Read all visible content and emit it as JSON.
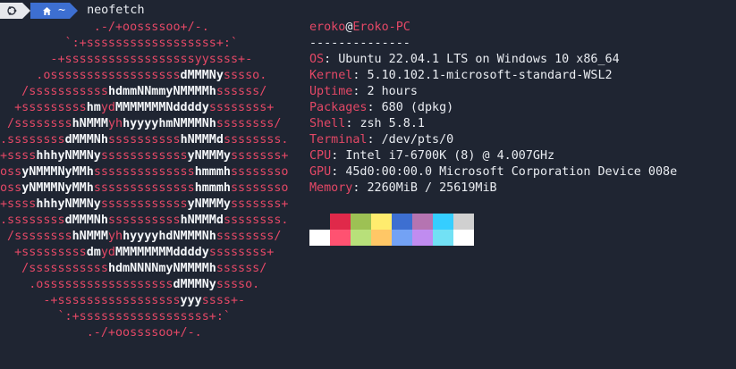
{
  "prompt": {
    "os_icon": "ubuntu-terminal-icon",
    "home_icon": "home-icon",
    "dir": "~",
    "command": "neofetch",
    "colors": {
      "os_segment": "#e6e8ec",
      "dir_segment": "#3d6fd1"
    }
  },
  "logo_lines": [
    [
      [
        "r",
        "             .-/+oossssoo+/-."
      ]
    ],
    [
      [
        "r",
        "         `:+ssssssssssssssssss+:`"
      ]
    ],
    [
      [
        "r",
        "       -+ssssssssssssssssssyyssss+-"
      ]
    ],
    [
      [
        "r",
        "     .ossssssssssssssssss"
      ],
      [
        "w",
        "dMMMNy"
      ],
      [
        "r",
        "sssso."
      ]
    ],
    [
      [
        "r",
        "   /sssssssssss"
      ],
      [
        "w",
        "hdmmNNmmyNMMMMh"
      ],
      [
        "r",
        "ssssss/"
      ]
    ],
    [
      [
        "r",
        "  +sssssssss"
      ],
      [
        "w",
        "hm"
      ],
      [
        "r",
        "yd"
      ],
      [
        "w",
        "MMMMMMMNddddy"
      ],
      [
        "r",
        "ssssssss+"
      ]
    ],
    [
      [
        "r",
        " /ssssssss"
      ],
      [
        "w",
        "hNMMM"
      ],
      [
        "r",
        "yh"
      ],
      [
        "w",
        "hyyyyhmNMMMNh"
      ],
      [
        "r",
        "ssssssss/"
      ]
    ],
    [
      [
        "r",
        ".ssssssss"
      ],
      [
        "w",
        "dMMMNh"
      ],
      [
        "r",
        "ssssssssss"
      ],
      [
        "w",
        "hNMMMd"
      ],
      [
        "r",
        "ssssssss."
      ]
    ],
    [
      [
        "r",
        "+ssss"
      ],
      [
        "w",
        "hhhyNMMNy"
      ],
      [
        "r",
        "ssssssssssss"
      ],
      [
        "w",
        "yNMMMy"
      ],
      [
        "r",
        "sssssss+"
      ]
    ],
    [
      [
        "r",
        "oss"
      ],
      [
        "w",
        "yNMMMNyMMh"
      ],
      [
        "r",
        "ssssssssssssss"
      ],
      [
        "w",
        "hmmmh"
      ],
      [
        "r",
        "ssssssso"
      ]
    ],
    [
      [
        "r",
        "oss"
      ],
      [
        "w",
        "yNMMMNyMMh"
      ],
      [
        "r",
        "ssssssssssssss"
      ],
      [
        "w",
        "hmmmh"
      ],
      [
        "r",
        "ssssssso"
      ]
    ],
    [
      [
        "r",
        "+ssss"
      ],
      [
        "w",
        "hhhyNMMNy"
      ],
      [
        "r",
        "ssssssssssss"
      ],
      [
        "w",
        "yNMMMy"
      ],
      [
        "r",
        "sssssss+"
      ]
    ],
    [
      [
        "r",
        ".ssssssss"
      ],
      [
        "w",
        "dMMMNh"
      ],
      [
        "r",
        "ssssssssss"
      ],
      [
        "w",
        "hNMMMd"
      ],
      [
        "r",
        "ssssssss."
      ]
    ],
    [
      [
        "r",
        " /ssssssss"
      ],
      [
        "w",
        "hNMMM"
      ],
      [
        "r",
        "yh"
      ],
      [
        "w",
        "hyyyyhdNMMMNh"
      ],
      [
        "r",
        "ssssssss/"
      ]
    ],
    [
      [
        "r",
        "  +sssssssss"
      ],
      [
        "w",
        "dm"
      ],
      [
        "r",
        "yd"
      ],
      [
        "w",
        "MMMMMMMMddddy"
      ],
      [
        "r",
        "ssssssss+"
      ]
    ],
    [
      [
        "r",
        "   /sssssssssss"
      ],
      [
        "w",
        "hdmNNNNmyNMMMMh"
      ],
      [
        "r",
        "ssssss/"
      ]
    ],
    [
      [
        "r",
        "    .ossssssssssssssssss"
      ],
      [
        "w",
        "dMMMNy"
      ],
      [
        "r",
        "sssso."
      ]
    ],
    [
      [
        "r",
        "      -+sssssssssssssssss"
      ],
      [
        "w",
        "yyy"
      ],
      [
        "r",
        "ssss+-"
      ]
    ],
    [
      [
        "r",
        "        `:+ssssssssssssssssss+:`"
      ]
    ],
    [
      [
        "r",
        "            .-/+oossssoo+/-."
      ]
    ]
  ],
  "info": {
    "user": "eroko",
    "at": "@",
    "host": "Eroko-PC",
    "separator": "--------------",
    "os_label": "OS",
    "os_value": "Ubuntu 22.04.1 LTS on Windows 10 x86_64",
    "kernel_label": "Kernel",
    "kernel_value": "5.10.102.1-microsoft-standard-WSL2",
    "uptime_label": "Uptime",
    "uptime_value": "2 hours",
    "packages_label": "Packages",
    "packages_value": "680 (dpkg)",
    "shell_label": "Shell",
    "shell_value": "zsh 5.8.1",
    "terminal_label": "Terminal",
    "terminal_value": "/dev/pts/0",
    "cpu_label": "CPU",
    "cpu_value": "Intel i7-6700K (8) @ 4.007GHz",
    "gpu_label": "GPU",
    "gpu_value": "45d0:00:00.0 Microsoft Corporation Device 008e",
    "memory_label": "Memory",
    "memory_value": "2260MiB / 25619MiB",
    "colon": ": "
  },
  "palette": {
    "normal": [
      "#1f2532",
      "#e0294a",
      "#9dc154",
      "#ffec6e",
      "#3d6fd1",
      "#b574b1",
      "#35ceff",
      "#d0d0d0"
    ],
    "bright": [
      "#ffffff",
      "#ff5271",
      "#b8e07a",
      "#ffc766",
      "#73a2f4",
      "#c08cf0",
      "#72e1f5",
      "#ffffff"
    ]
  }
}
